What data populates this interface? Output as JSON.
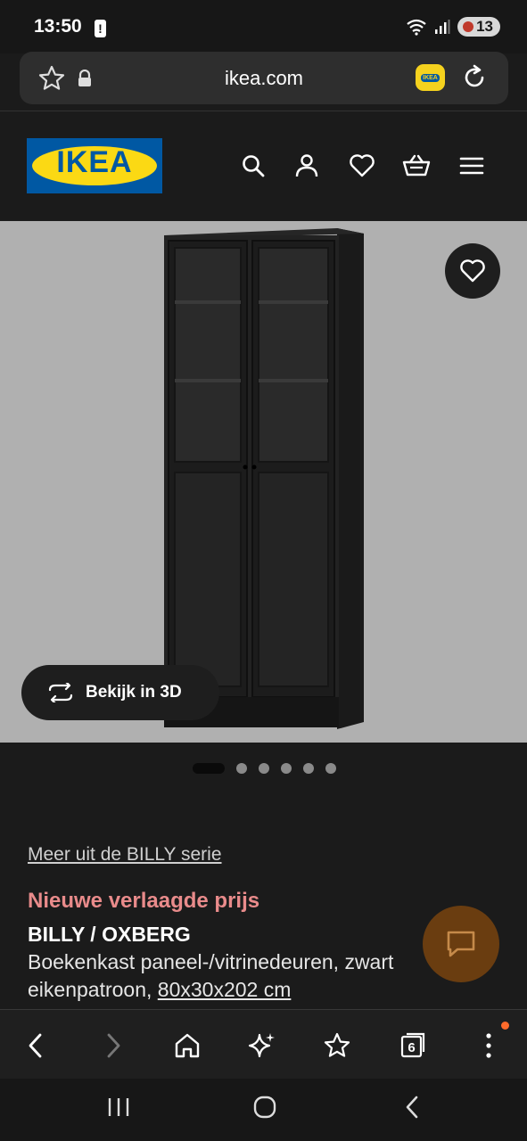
{
  "status_bar": {
    "time": "13:50",
    "battery_level": "13"
  },
  "browser": {
    "url": "ikea.com",
    "tab_count": "6"
  },
  "ikea_logo": "IKEA",
  "product": {
    "view3d_label": "Bekijk in 3D",
    "carousel_total": 6,
    "carousel_active": 1,
    "series_link": "Meer uit de BILLY serie",
    "promo": "Nieuwe verlaagde prijs",
    "name": "BILLY / OXBERG",
    "description": "Boekenkast paneel-/vitrinedeuren, zwart eikenpatroon,",
    "size": "80x30x202 cm"
  },
  "colors": {
    "promo": "#e98b8b",
    "logo_blue": "#0058a3",
    "logo_yellow": "#fbd914"
  }
}
